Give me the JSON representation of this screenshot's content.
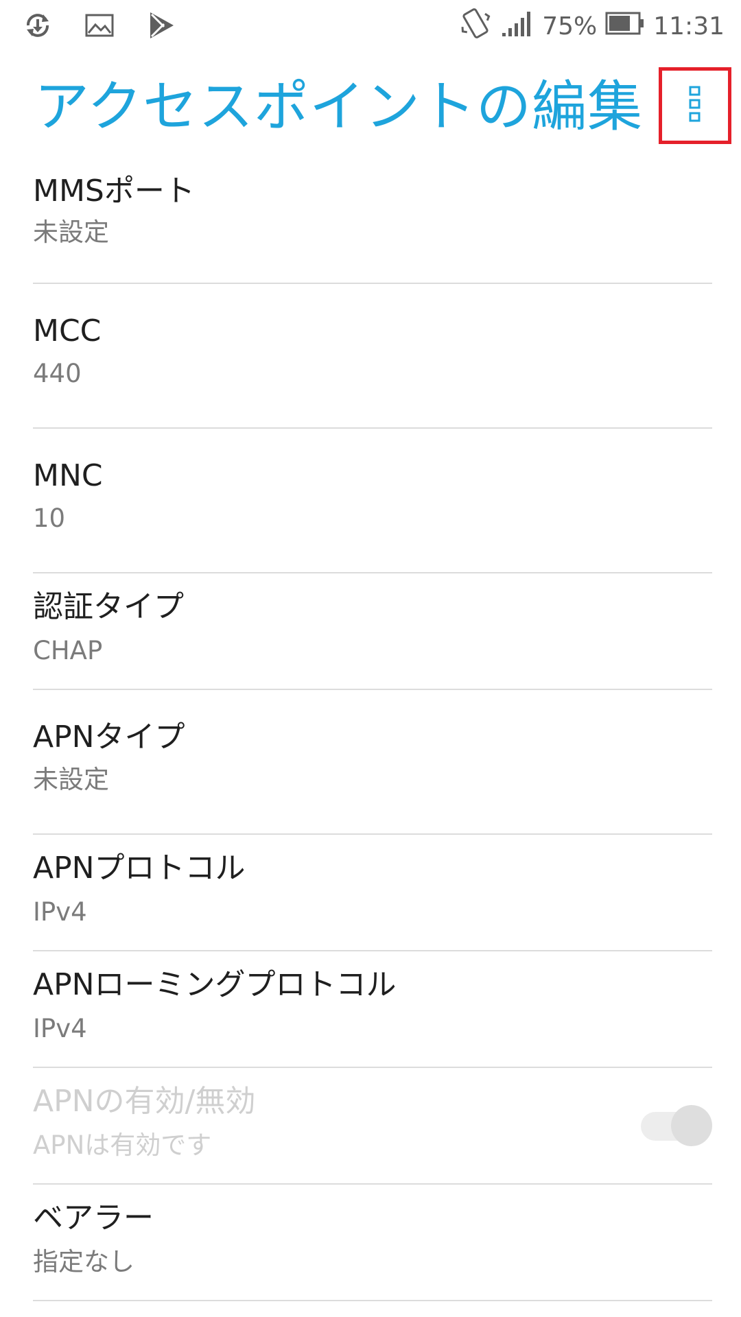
{
  "status_bar": {
    "left_icons": [
      "sync-download-icon",
      "image-icon",
      "play-store-icon"
    ],
    "battery_percent": "75%",
    "time": "11:31"
  },
  "header": {
    "title": "アクセスポイントの編集",
    "menu_icon": "overflow-menu-icon",
    "highlight_color": "#e5202a"
  },
  "colors": {
    "accent": "#1ea4dc"
  },
  "settings": {
    "mms_port": {
      "title": "MMSポート",
      "value": "未設定"
    },
    "mcc": {
      "title": "MCC",
      "value": "440"
    },
    "mnc": {
      "title": "MNC",
      "value": "10"
    },
    "auth_type": {
      "title": "認証タイプ",
      "value": "CHAP"
    },
    "apn_type": {
      "title": "APNタイプ",
      "value": "未設定"
    },
    "apn_protocol": {
      "title": "APNプロトコル",
      "value": "IPv4"
    },
    "apn_roaming_protocol": {
      "title": "APNローミングプロトコル",
      "value": "IPv4"
    },
    "apn_enable": {
      "title": "APNの有効/無効",
      "value": "APNは有効です",
      "enabled": true,
      "disabled_state": true
    },
    "bearer": {
      "title": "ベアラー",
      "value": "指定なし"
    }
  }
}
